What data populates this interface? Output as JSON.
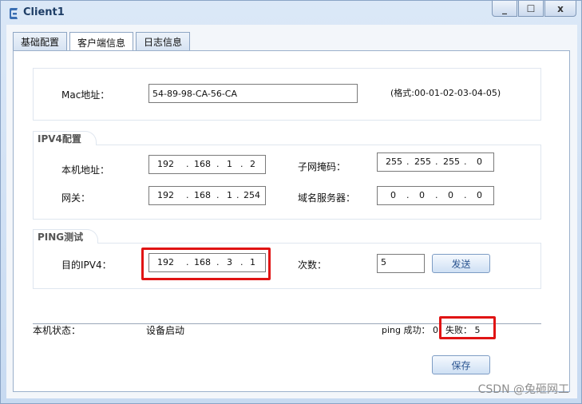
{
  "window": {
    "title": "Client1",
    "controls": {
      "minimize": "_",
      "maximize": "☐",
      "close": "x"
    }
  },
  "tabs": [
    "基础配置",
    "客户端信息",
    "日志信息"
  ],
  "mac": {
    "label": "Mac地址：",
    "value": "54-89-98-CA-56-CA",
    "hint": "(格式:00-01-02-03-04-05)"
  },
  "ipv4": {
    "title": "IPV4配置",
    "host_label": "本机地址：",
    "host": [
      "192",
      "168",
      "1",
      "2"
    ],
    "mask_label": "子网掩码：",
    "mask": [
      "255",
      "255",
      "255",
      "0"
    ],
    "gateway_label": "网关：",
    "gateway": [
      "192",
      "168",
      "1",
      "254"
    ],
    "dns_label": "域名服务器：",
    "dns": [
      "0",
      "0",
      "0",
      "0"
    ]
  },
  "ping": {
    "title": "PING测试",
    "target_label": "目的IPV4：",
    "target": [
      "192",
      "168",
      "3",
      "1"
    ],
    "count_label": "次数：",
    "count": "5",
    "send_label": "发送"
  },
  "status": {
    "label": "本机状态：",
    "value": "设备启动",
    "success_text": "ping 成功： 0",
    "fail_text": "失败： 5"
  },
  "save_label": "保存",
  "watermark": "CSDN @兔砸网工",
  "colors": {
    "highlight": "#e01414",
    "button_text": "#2a5490"
  }
}
